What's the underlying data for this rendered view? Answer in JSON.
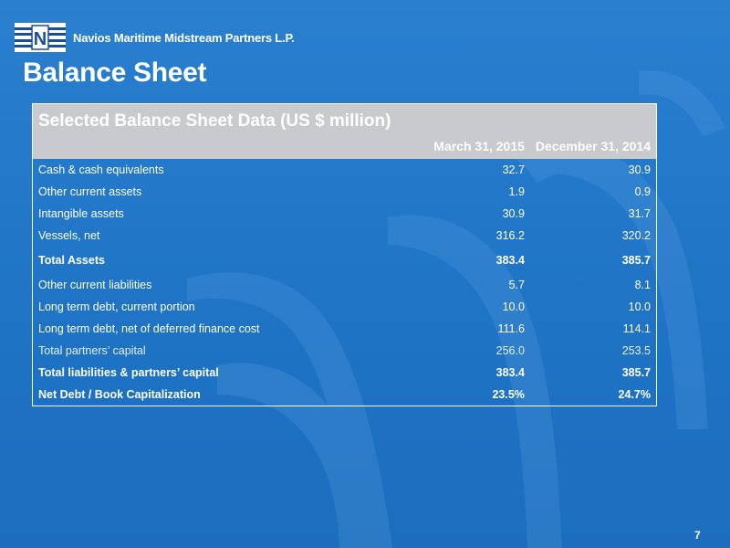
{
  "header": {
    "company_name": "Navios Maritime Midstream Partners L.P.",
    "logo_letter": "N"
  },
  "slide": {
    "title": "Balance Sheet",
    "page_number": "7"
  },
  "table": {
    "title": "Selected Balance Sheet Data (US $ million)",
    "columns": [
      "",
      "March 31, 2015",
      "December 31, 2014"
    ],
    "rows": [
      {
        "label": "Cash & cash equivalents",
        "mar_2015": "32.7",
        "dec_2014": "30.9"
      },
      {
        "label": "Other current assets",
        "mar_2015": "1.9",
        "dec_2014": "0.9"
      },
      {
        "label": "Intangible assets",
        "mar_2015": "30.9",
        "dec_2014": "31.7"
      },
      {
        "label": "Vessels, net",
        "mar_2015": "316.2",
        "dec_2014": "320.2"
      },
      {
        "label": "Total Assets",
        "mar_2015": "383.4",
        "dec_2014": "385.7"
      },
      {
        "label": "Other current liabilities",
        "mar_2015": "5.7",
        "dec_2014": "8.1"
      },
      {
        "label": "Long term debt, current portion",
        "mar_2015": "10.0",
        "dec_2014": "10.0"
      },
      {
        "label": "Long term debt, net of deferred finance cost",
        "mar_2015": "111.6",
        "dec_2014": "114.1"
      },
      {
        "label": "Total partners’ capital",
        "mar_2015": "256.0",
        "dec_2014": "253.5"
      },
      {
        "label": "Total liabilities & partners’ capital",
        "mar_2015": "383.4",
        "dec_2014": "385.7"
      },
      {
        "label": "Net Debt / Book Capitalization",
        "mar_2015": "23.5%",
        "dec_2014": "24.7%"
      }
    ]
  },
  "colors": {
    "background": "#1f74c6",
    "table_header": "#c9cacd",
    "text": "#ffffff"
  }
}
